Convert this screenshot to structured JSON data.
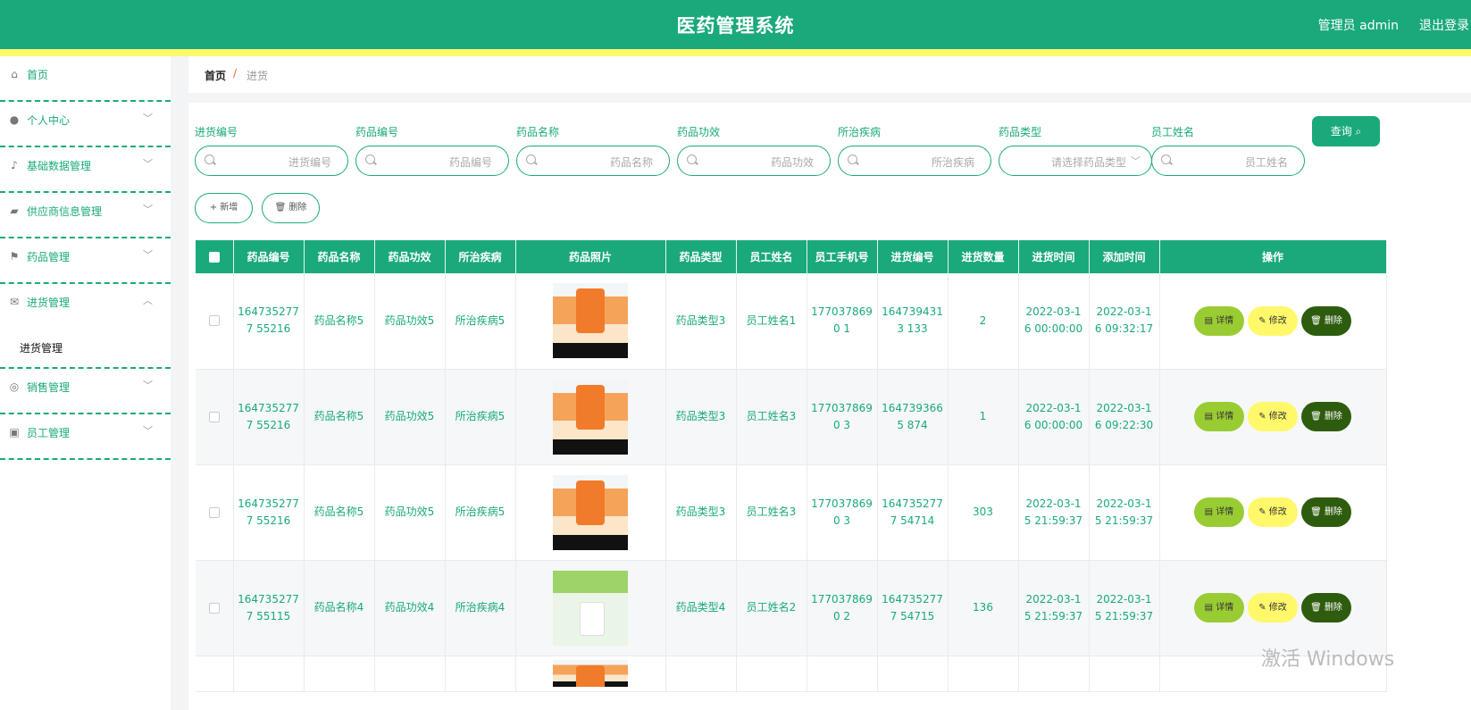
{
  "header": {
    "title": "医药管理系统",
    "user": "管理员 admin",
    "logout": "退出登录"
  },
  "sidebar": {
    "items": [
      {
        "label": "首页",
        "icon": "home-icon",
        "chevron": false
      },
      {
        "label": "个人中心",
        "icon": "user-icon",
        "chevron": true
      },
      {
        "label": "基础数据管理",
        "icon": "microphone-icon",
        "chevron": true
      },
      {
        "label": "供应商信息管理",
        "icon": "wallet-icon",
        "chevron": true
      },
      {
        "label": "药品管理",
        "icon": "flag-icon",
        "chevron": true
      },
      {
        "label": "进货管理",
        "icon": "mail-icon",
        "chevron": true,
        "expanded": true,
        "sub": "进货管理"
      },
      {
        "label": "销售管理",
        "icon": "lifebuoy-icon",
        "chevron": true
      },
      {
        "label": "员工管理",
        "icon": "briefcase-icon",
        "chevron": true
      }
    ]
  },
  "breadcrumb": {
    "home": "首页",
    "sep": "/",
    "current": "进货"
  },
  "search": {
    "fields": [
      {
        "label": "进货编号",
        "placeholder": "进货编号"
      },
      {
        "label": "药品编号",
        "placeholder": "药品编号"
      },
      {
        "label": "药品名称",
        "placeholder": "药品名称"
      },
      {
        "label": "药品功效",
        "placeholder": "药品功效"
      },
      {
        "label": "所治疾病",
        "placeholder": "所治疾病"
      },
      {
        "label": "药品类型",
        "placeholder": "请选择药品类型"
      },
      {
        "label": "员工姓名",
        "placeholder": "员工姓名"
      }
    ],
    "query": "查询 ⌕",
    "add": "+ 新增",
    "delete": "🗑 删除"
  },
  "table": {
    "headers": [
      "药品编号",
      "药品名称",
      "药品功效",
      "所治疾病",
      "药品照片",
      "药品类型",
      "员工姓名",
      "员工手机号",
      "进货编号",
      "进货数量",
      "进货时间",
      "添加时间",
      "操作"
    ],
    "rows": [
      {
        "code": "1647352777 55216",
        "name": "药品名称5",
        "effect": "药品功效5",
        "disease": "所治疾病5",
        "photo": "orange",
        "type": "药品类型3",
        "emp": "员工姓名1",
        "phone": "1770378690 1",
        "inno": "1647394313 133",
        "qty": "2",
        "intime": "2022-03-1 6 00:00:00",
        "addtime": "2022-03-1 6 09:32:17"
      },
      {
        "code": "1647352777 55216",
        "name": "药品名称5",
        "effect": "药品功效5",
        "disease": "所治疾病5",
        "photo": "orange",
        "type": "药品类型3",
        "emp": "员工姓名3",
        "phone": "1770378690 3",
        "inno": "1647393665 874",
        "qty": "1",
        "intime": "2022-03-1 6 00:00:00",
        "addtime": "2022-03-1 6 09:22:30"
      },
      {
        "code": "1647352777 55216",
        "name": "药品名称5",
        "effect": "药品功效5",
        "disease": "所治疾病5",
        "photo": "orange",
        "type": "药品类型3",
        "emp": "员工姓名3",
        "phone": "1770378690 3",
        "inno": "1647352777 54714",
        "qty": "303",
        "intime": "2022-03-1 5 21:59:37",
        "addtime": "2022-03-1 5 21:59:37"
      },
      {
        "code": "1647352777 55115",
        "name": "药品名称4",
        "effect": "药品功效4",
        "disease": "所治疾病4",
        "photo": "green",
        "type": "药品类型4",
        "emp": "员工姓名2",
        "phone": "1770378690 2",
        "inno": "1647352777 54715",
        "qty": "136",
        "intime": "2022-03-1 5 21:59:37",
        "addtime": "2022-03-1 5 21:59:37"
      }
    ],
    "actions": {
      "detail": "▤ 详情",
      "edit": "✎ 修改",
      "delete": "🗑 删除"
    }
  },
  "watermark": "激活 Windows"
}
